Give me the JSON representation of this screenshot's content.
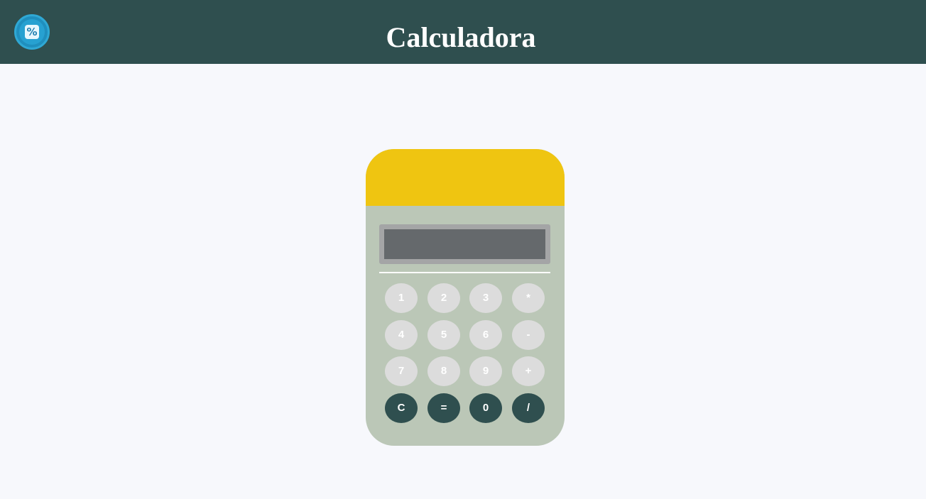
{
  "header": {
    "title": "Calculadora",
    "logo_icon": "percent-icon",
    "logo_symbol": "%"
  },
  "calculator": {
    "display_value": "",
    "keys": [
      [
        "1",
        "2",
        "3",
        "*"
      ],
      [
        "4",
        "5",
        "6",
        "-"
      ],
      [
        "7",
        "8",
        "9",
        "+"
      ],
      [
        "C",
        "=",
        "0",
        "/"
      ]
    ]
  },
  "colors": {
    "header_bg": "#2f4f4f",
    "page_bg": "#f7f8fc",
    "calculator_body": "#bbc7b7",
    "calculator_top": "#efc511",
    "display_bg": "#65696c",
    "display_border": "#a4a5a6",
    "key_light": "#dcdcdc",
    "key_dark": "#2f4f4f"
  }
}
